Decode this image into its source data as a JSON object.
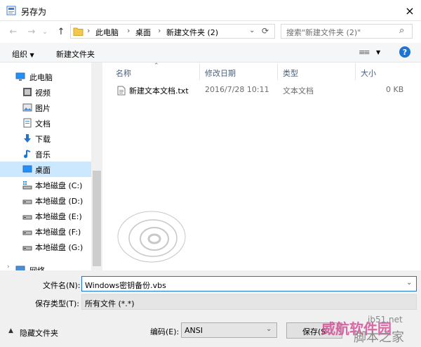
{
  "window": {
    "title": "另存为",
    "close_icon": "×"
  },
  "nav": {
    "back_icon": "←",
    "forward_icon": "→",
    "dropdown_icon": "⌄",
    "up_icon": "↑",
    "breadcrumb": [
      "此电脑",
      "桌面",
      "新建文件夹 (2)"
    ],
    "refresh_icon": "⟳",
    "search_placeholder": "搜索\"新建文件夹 (2)\"",
    "search_icon": "⌕"
  },
  "toolbar": {
    "organize": "组织",
    "new_folder": "新建文件夹",
    "view_icon": "≡≡",
    "help": "?"
  },
  "sidebar": {
    "items": [
      {
        "label": "此电脑",
        "icon": "computer-icon"
      },
      {
        "label": "视频",
        "icon": "video-icon"
      },
      {
        "label": "图片",
        "icon": "picture-icon"
      },
      {
        "label": "文档",
        "icon": "document-icon"
      },
      {
        "label": "下载",
        "icon": "download-icon"
      },
      {
        "label": "音乐",
        "icon": "music-icon"
      },
      {
        "label": "桌面",
        "icon": "desktop-icon",
        "selected": true
      },
      {
        "label": "本地磁盘 (C:)",
        "icon": "system-drive-icon"
      },
      {
        "label": "本地磁盘 (D:)",
        "icon": "drive-icon"
      },
      {
        "label": "本地磁盘 (E:)",
        "icon": "drive-icon"
      },
      {
        "label": "本地磁盘 (F:)",
        "icon": "drive-icon"
      },
      {
        "label": "本地磁盘 (G:)",
        "icon": "drive-icon"
      },
      {
        "label": "网络",
        "icon": "network-icon"
      }
    ]
  },
  "file_list": {
    "columns": [
      "名称",
      "修改日期",
      "类型",
      "大小"
    ],
    "rows": [
      {
        "name": "新建文本文档.txt",
        "modified": "2016/7/28 10:11",
        "type": "文本文档",
        "size": "0 KB"
      }
    ]
  },
  "form": {
    "filename_label": "文件名(N):",
    "filename_value": "Windows密钥备份.vbs",
    "filetype_label": "保存类型(T):",
    "filetype_value": "所有文件  (*.*)",
    "encoding_label": "编码(E):",
    "encoding_value": "ANSI",
    "save_button": "保存(S",
    "hide_folders": "隐藏文件夹"
  },
  "watermark": {
    "text1": "威航软件园",
    "text2": "jb51.net",
    "text3": "脚本之家"
  },
  "colors": {
    "accent": "#1e74d1",
    "selection": "#cce8ff",
    "folder": "#f2c94c"
  }
}
